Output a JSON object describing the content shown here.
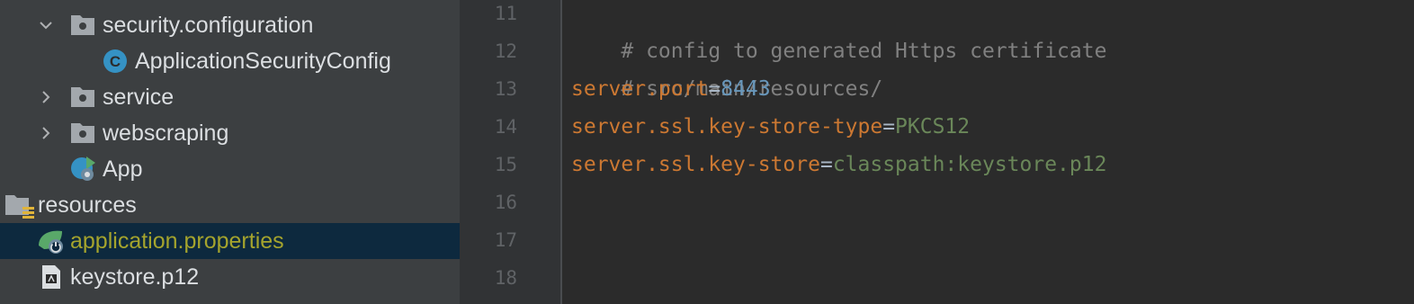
{
  "project_tree": {
    "items": [
      {
        "label": "security.configuration",
        "type": "package",
        "expanded": true,
        "icon": "folder-package-icon"
      },
      {
        "label": "ApplicationSecurityConfig",
        "type": "class",
        "icon": "java-class-icon"
      },
      {
        "label": "service",
        "type": "package",
        "expanded": false,
        "icon": "folder-package-icon"
      },
      {
        "label": "webscraping",
        "type": "package",
        "expanded": false,
        "icon": "folder-package-icon"
      },
      {
        "label": "App",
        "type": "spring-boot-app",
        "icon": "spring-app-icon"
      },
      {
        "label": "resources",
        "type": "resources-folder",
        "icon": "resources-folder-icon"
      },
      {
        "label": "application.properties",
        "type": "properties",
        "selected": true,
        "icon": "spring-properties-icon"
      },
      {
        "label": "keystore.p12",
        "type": "file",
        "icon": "file-icon"
      }
    ]
  },
  "editor": {
    "lines": [
      {
        "number": "11",
        "comment": "# config to generated Https certificate"
      },
      {
        "number": "12",
        "comment": "# src/main/resources/"
      },
      {
        "number": "13",
        "key": "server.port",
        "eq": "=",
        "value": "8443",
        "value_type": "number"
      },
      {
        "number": "14",
        "key": "server.ssl.key-store-type",
        "eq": "=",
        "value": "PKCS12",
        "value_type": "string"
      },
      {
        "number": "15",
        "key": "server.ssl.key-store",
        "eq": "=",
        "value": "classpath:keystore.p12",
        "value_type": "string"
      },
      {
        "number": "16"
      },
      {
        "number": "17"
      },
      {
        "number": "18"
      }
    ]
  },
  "colors": {
    "tree_background": "#3c3f41",
    "selection": "#0d293e",
    "editor_background": "#2b2b2b",
    "comment": "#808080",
    "property_key": "#cc7832",
    "number_value": "#6897bb",
    "string_value": "#6a8759"
  }
}
